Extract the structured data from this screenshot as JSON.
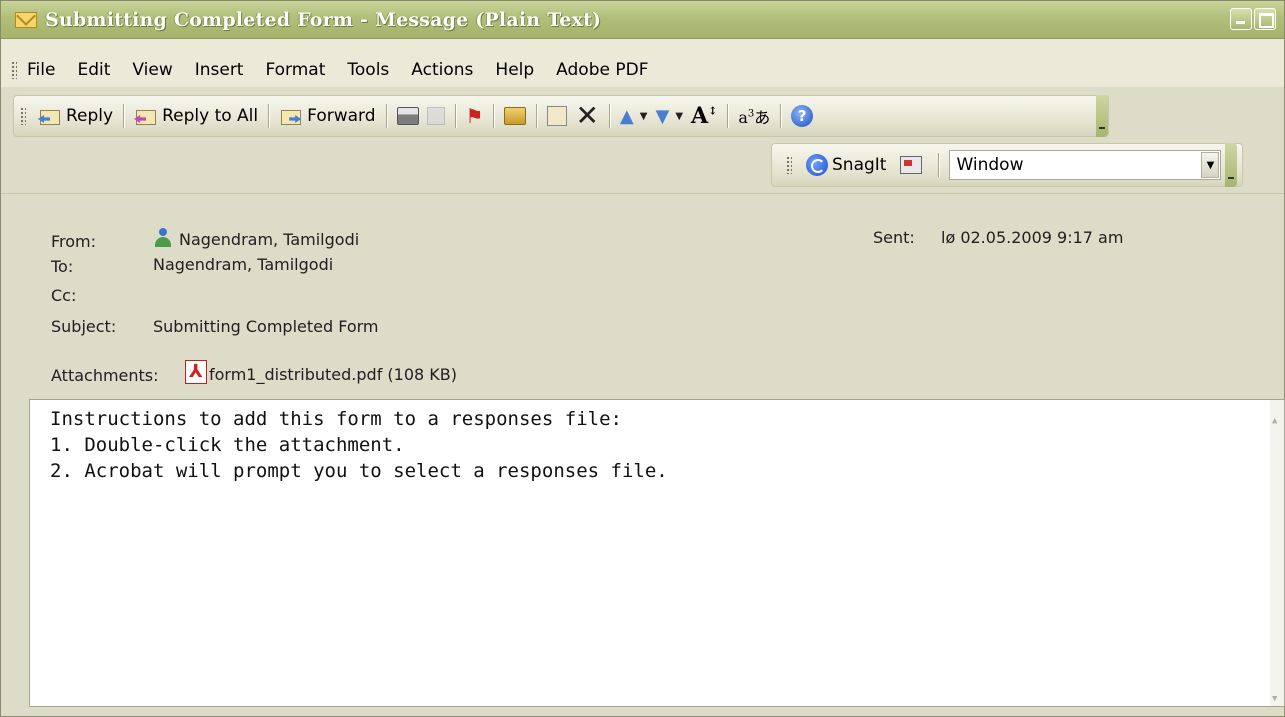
{
  "window": {
    "title": "Submitting Completed Form - Message (Plain Text)"
  },
  "menu": {
    "file": "File",
    "edit": "Edit",
    "view": "View",
    "insert": "Insert",
    "format": "Format",
    "tools": "Tools",
    "actions": "Actions",
    "help": "Help",
    "adobe_pdf": "Adobe PDF"
  },
  "toolbar": {
    "reply": "Reply",
    "reply_all": "Reply to All",
    "forward": "Forward"
  },
  "snagit": {
    "label": "SnagIt",
    "combo_value": "Window"
  },
  "header": {
    "from_label": "From:",
    "from_value": "Nagendram, Tamilgodi",
    "sent_label": "Sent:",
    "sent_value": "lø 02.05.2009 9:17 am",
    "to_label": "To:",
    "to_value": "Nagendram, Tamilgodi",
    "cc_label": "Cc:",
    "cc_value": "",
    "subject_label": "Subject:",
    "subject_value": "Submitting Completed Form",
    "attachments_label": "Attachments:",
    "attachment_name": "form1_distributed.pdf (108 KB)"
  },
  "body": {
    "lines": [
      "Instructions to add this form to a responses file:",
      "1. Double-click the attachment.",
      "2. Acrobat will prompt you to select a responses file."
    ]
  },
  "colors": {
    "titlebar": "#b2bf79",
    "chrome": "#ece9d8",
    "header_bg": "#dcdcc8"
  }
}
